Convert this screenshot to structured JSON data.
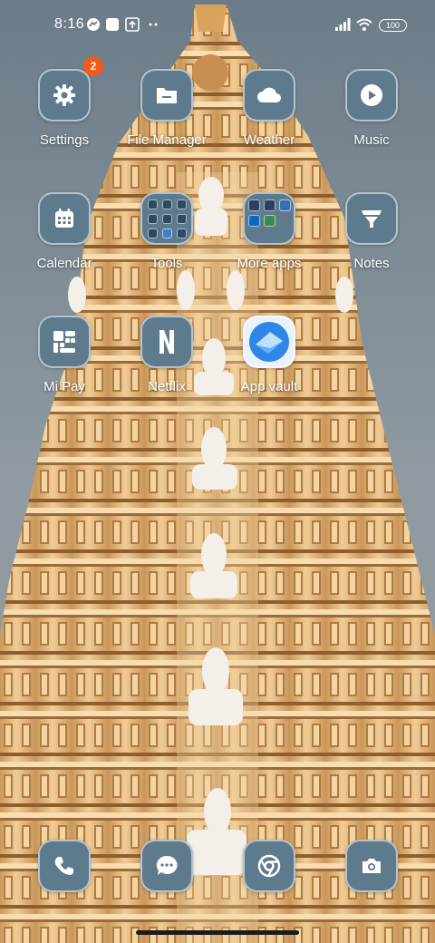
{
  "status_bar": {
    "time": "8:16",
    "battery": "100",
    "icons": [
      "messenger-icon",
      "square-app-icon",
      "upload-notification-icon",
      "more-dots-icon",
      "signal-icon",
      "wifi-icon",
      "battery-icon"
    ]
  },
  "apps": [
    {
      "label": "Settings",
      "icon": "gear-icon",
      "badge": "2"
    },
    {
      "label": "File Manager",
      "icon": "folder-icon"
    },
    {
      "label": "Weather",
      "icon": "cloud-icon"
    },
    {
      "label": "Music",
      "icon": "play-icon"
    },
    {
      "label": "Calendar",
      "icon": "calendar-icon"
    },
    {
      "label": "Tools",
      "icon": "folder-tools-icon"
    },
    {
      "label": "More apps",
      "icon": "folder-more-apps-icon"
    },
    {
      "label": "Notes",
      "icon": "notes-icon"
    },
    {
      "label": "Mi Pay",
      "icon": "mi-pay-icon"
    },
    {
      "label": "Netflix",
      "icon": "netflix-icon"
    },
    {
      "label": "App vault",
      "icon": "app-vault-icon"
    }
  ],
  "dock": [
    {
      "name": "phone",
      "icon": "phone-icon"
    },
    {
      "name": "messages",
      "icon": "message-icon"
    },
    {
      "name": "browser",
      "icon": "chrome-icon"
    },
    {
      "name": "camera",
      "icon": "camera-icon"
    }
  ],
  "colors": {
    "tile": "#5e7b8e",
    "badge": "#f25a1c",
    "sky": "#7d8c97",
    "temple": "#e6b97e"
  }
}
